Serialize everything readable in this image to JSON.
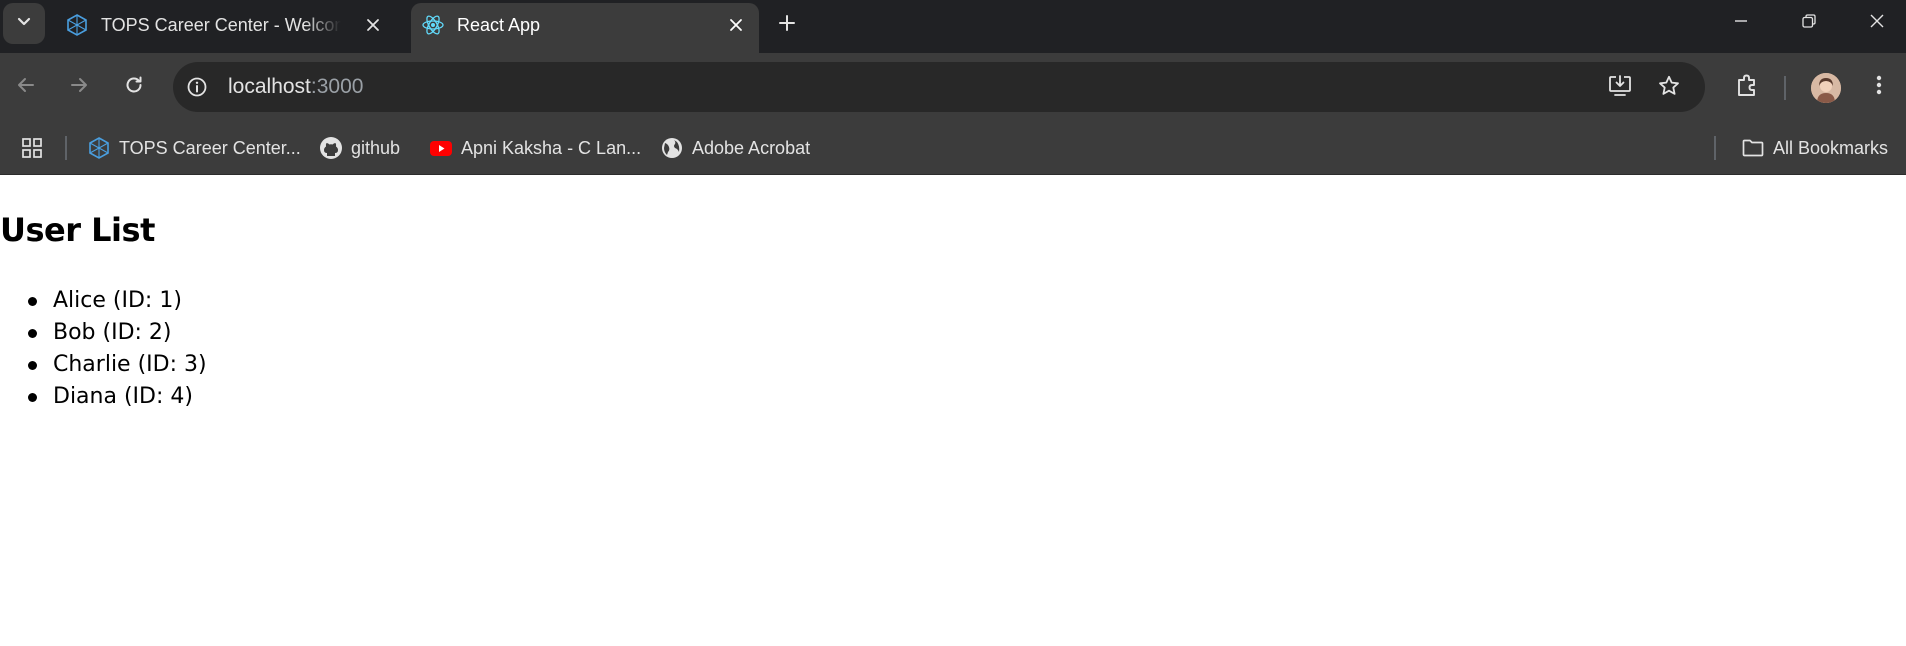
{
  "tabs": [
    {
      "title": "TOPS Career Center - Welcome",
      "active": false,
      "favicon": "tops-logo-icon"
    },
    {
      "title": "React App",
      "active": true,
      "favicon": "react-logo-icon"
    }
  ],
  "toolbar": {
    "url_host": "localhost",
    "url_port": ":3000"
  },
  "bookmarks": [
    {
      "label": "TOPS Career Center...",
      "icon": "tops-logo-icon"
    },
    {
      "label": "github",
      "icon": "github-icon"
    },
    {
      "label": "Apni Kaksha - C Lan...",
      "icon": "youtube-icon"
    },
    {
      "label": "Adobe Acrobat",
      "icon": "globe-icon"
    }
  ],
  "all_bookmarks_label": "All Bookmarks",
  "page": {
    "title": "User List",
    "users": [
      {
        "text": "Alice (ID: 1)"
      },
      {
        "text": "Bob (ID: 2)"
      },
      {
        "text": "Charlie (ID: 3)"
      },
      {
        "text": "Diana (ID: 4)"
      }
    ]
  },
  "colors": {
    "tabstrip_bg": "#202124",
    "toolbar_bg": "#3c3c3c",
    "omnibox_bg": "#282828",
    "react_blue": "#61dafb",
    "youtube_red": "#ff0000"
  }
}
